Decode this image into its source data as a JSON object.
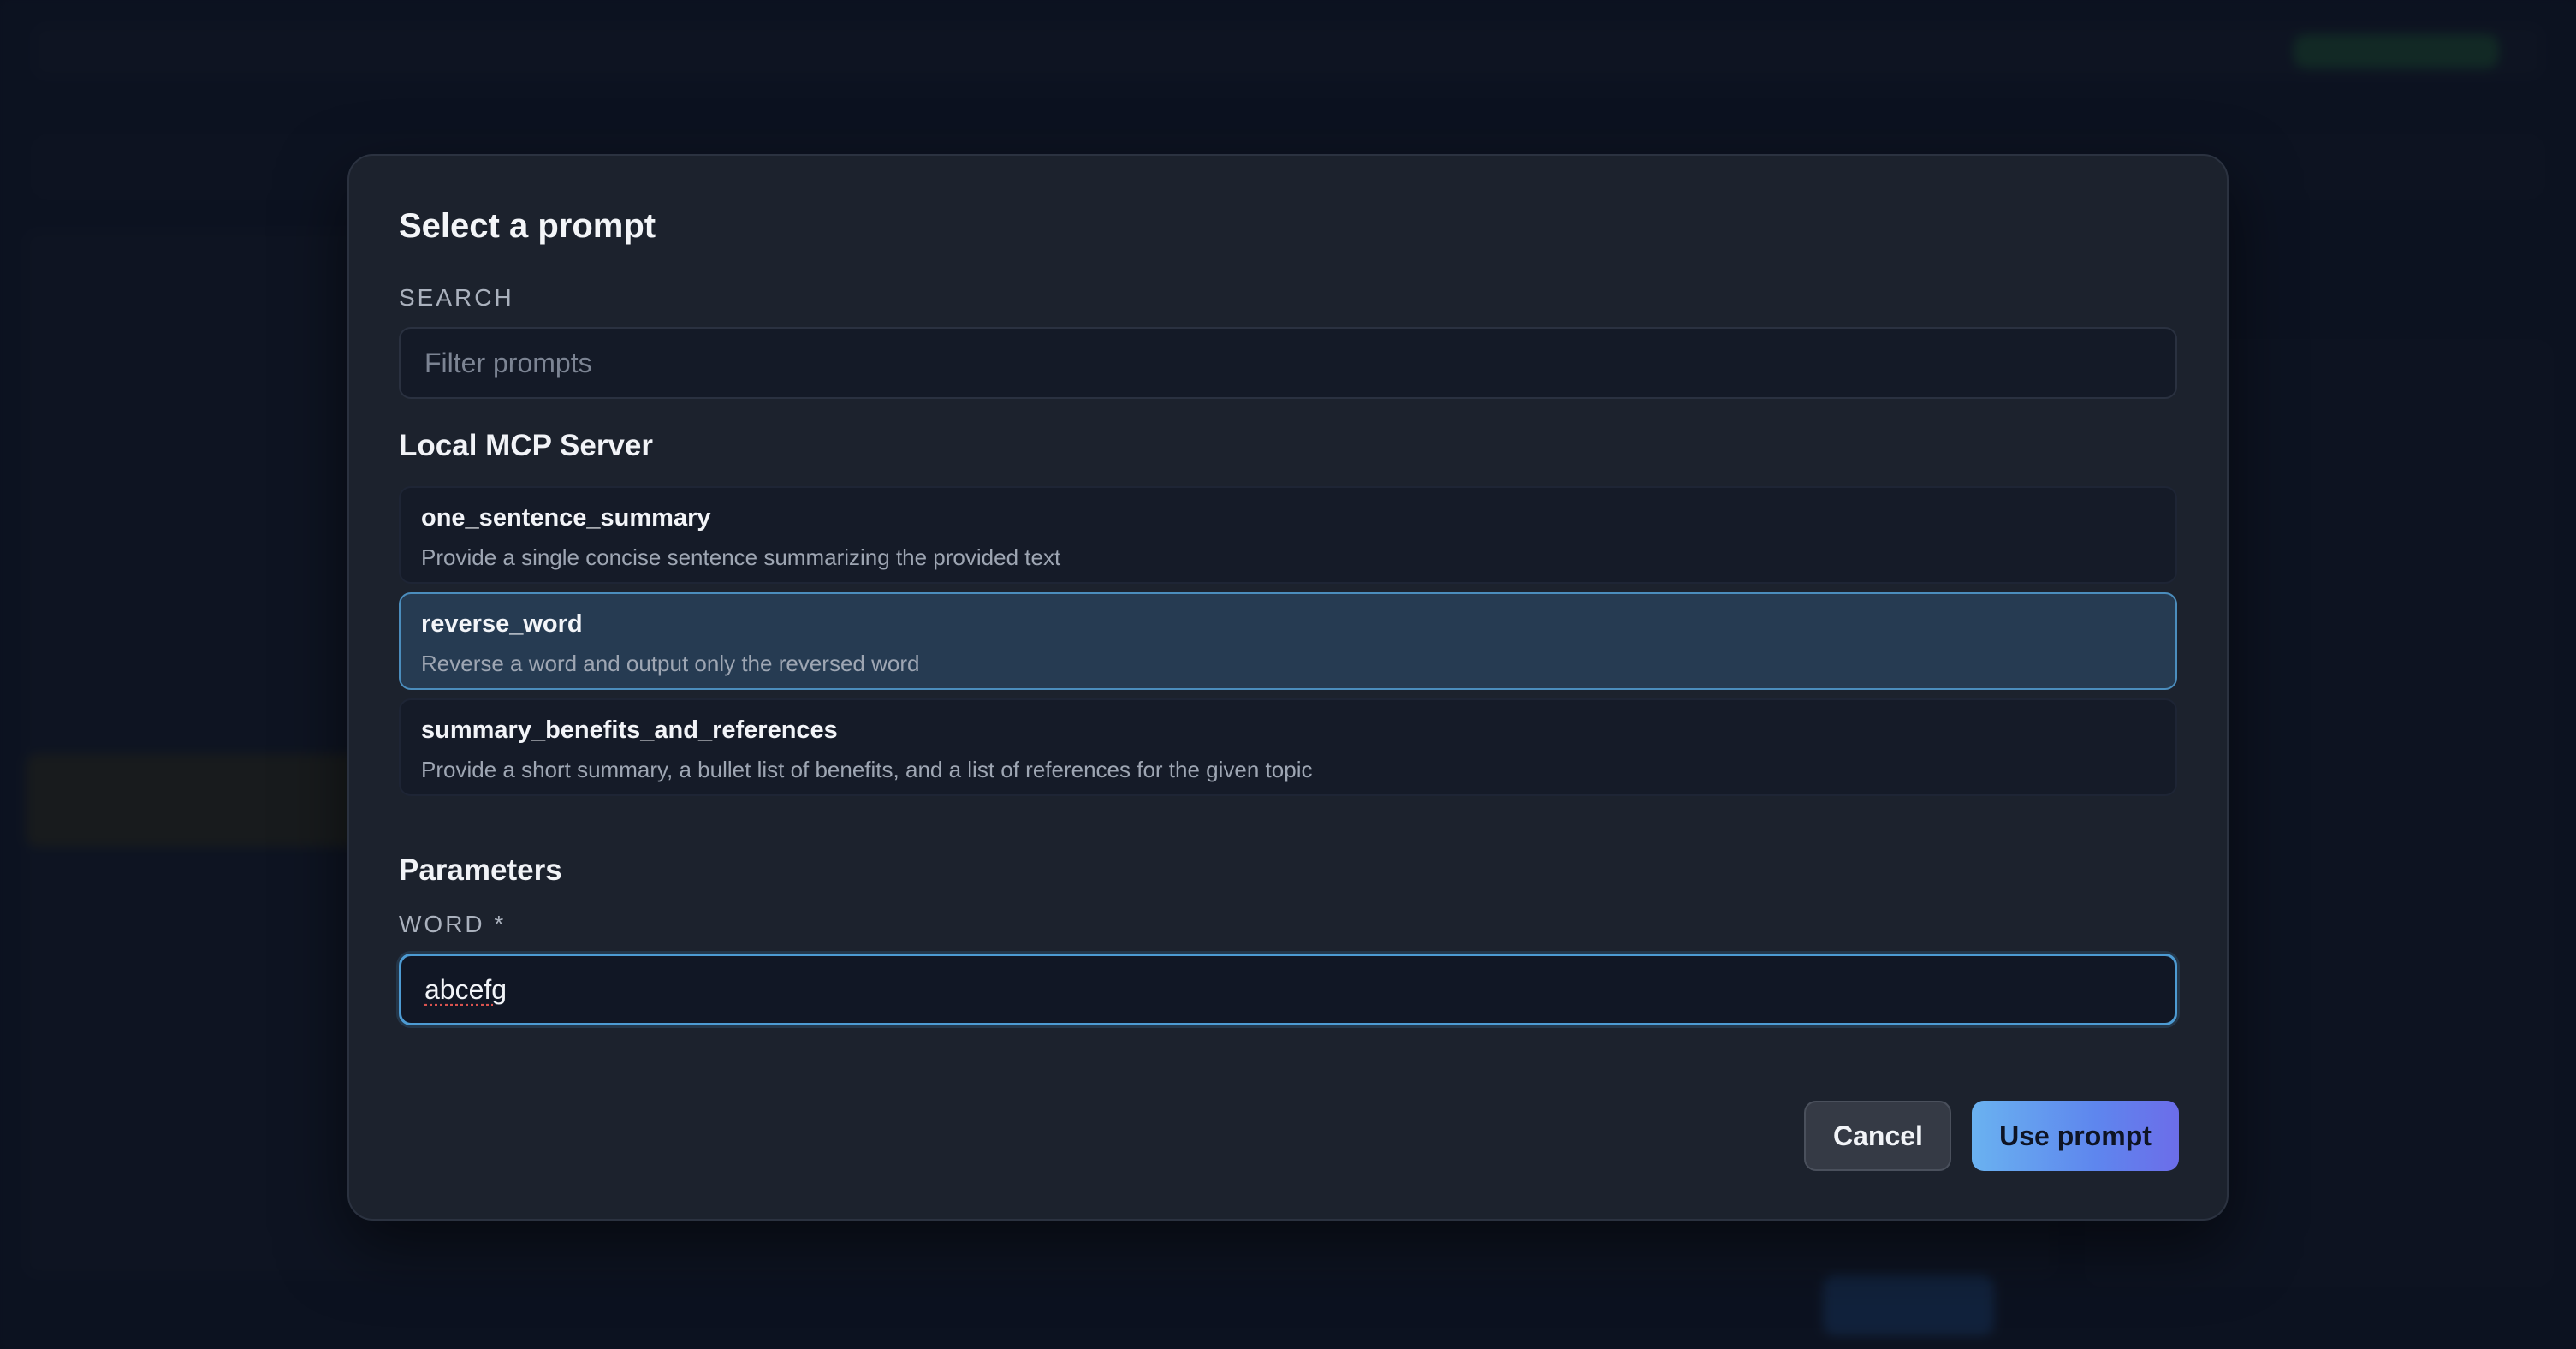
{
  "modal": {
    "title": "Select a prompt",
    "search": {
      "label": "SEARCH",
      "placeholder": "Filter prompts",
      "value": ""
    },
    "group_title": "Local MCP Server",
    "prompts": [
      {
        "name": "one_sentence_summary",
        "description": "Provide a single concise sentence summarizing the provided text",
        "selected": false
      },
      {
        "name": "reverse_word",
        "description": "Reverse a word and output only the reversed word",
        "selected": true
      },
      {
        "name": "summary_benefits_and_references",
        "description": "Provide a short summary, a bullet list of benefits, and a list of references for the given topic",
        "selected": false
      }
    ],
    "parameters": {
      "title": "Parameters",
      "word_label": "WORD *",
      "word_value": "abcefg"
    },
    "buttons": {
      "cancel": "Cancel",
      "use_prompt": "Use prompt"
    }
  },
  "colors": {
    "accent": "#4d9bd3",
    "selected_bg": "#263b52",
    "modal_bg": "#1c222d",
    "backdrop": "#111829"
  }
}
